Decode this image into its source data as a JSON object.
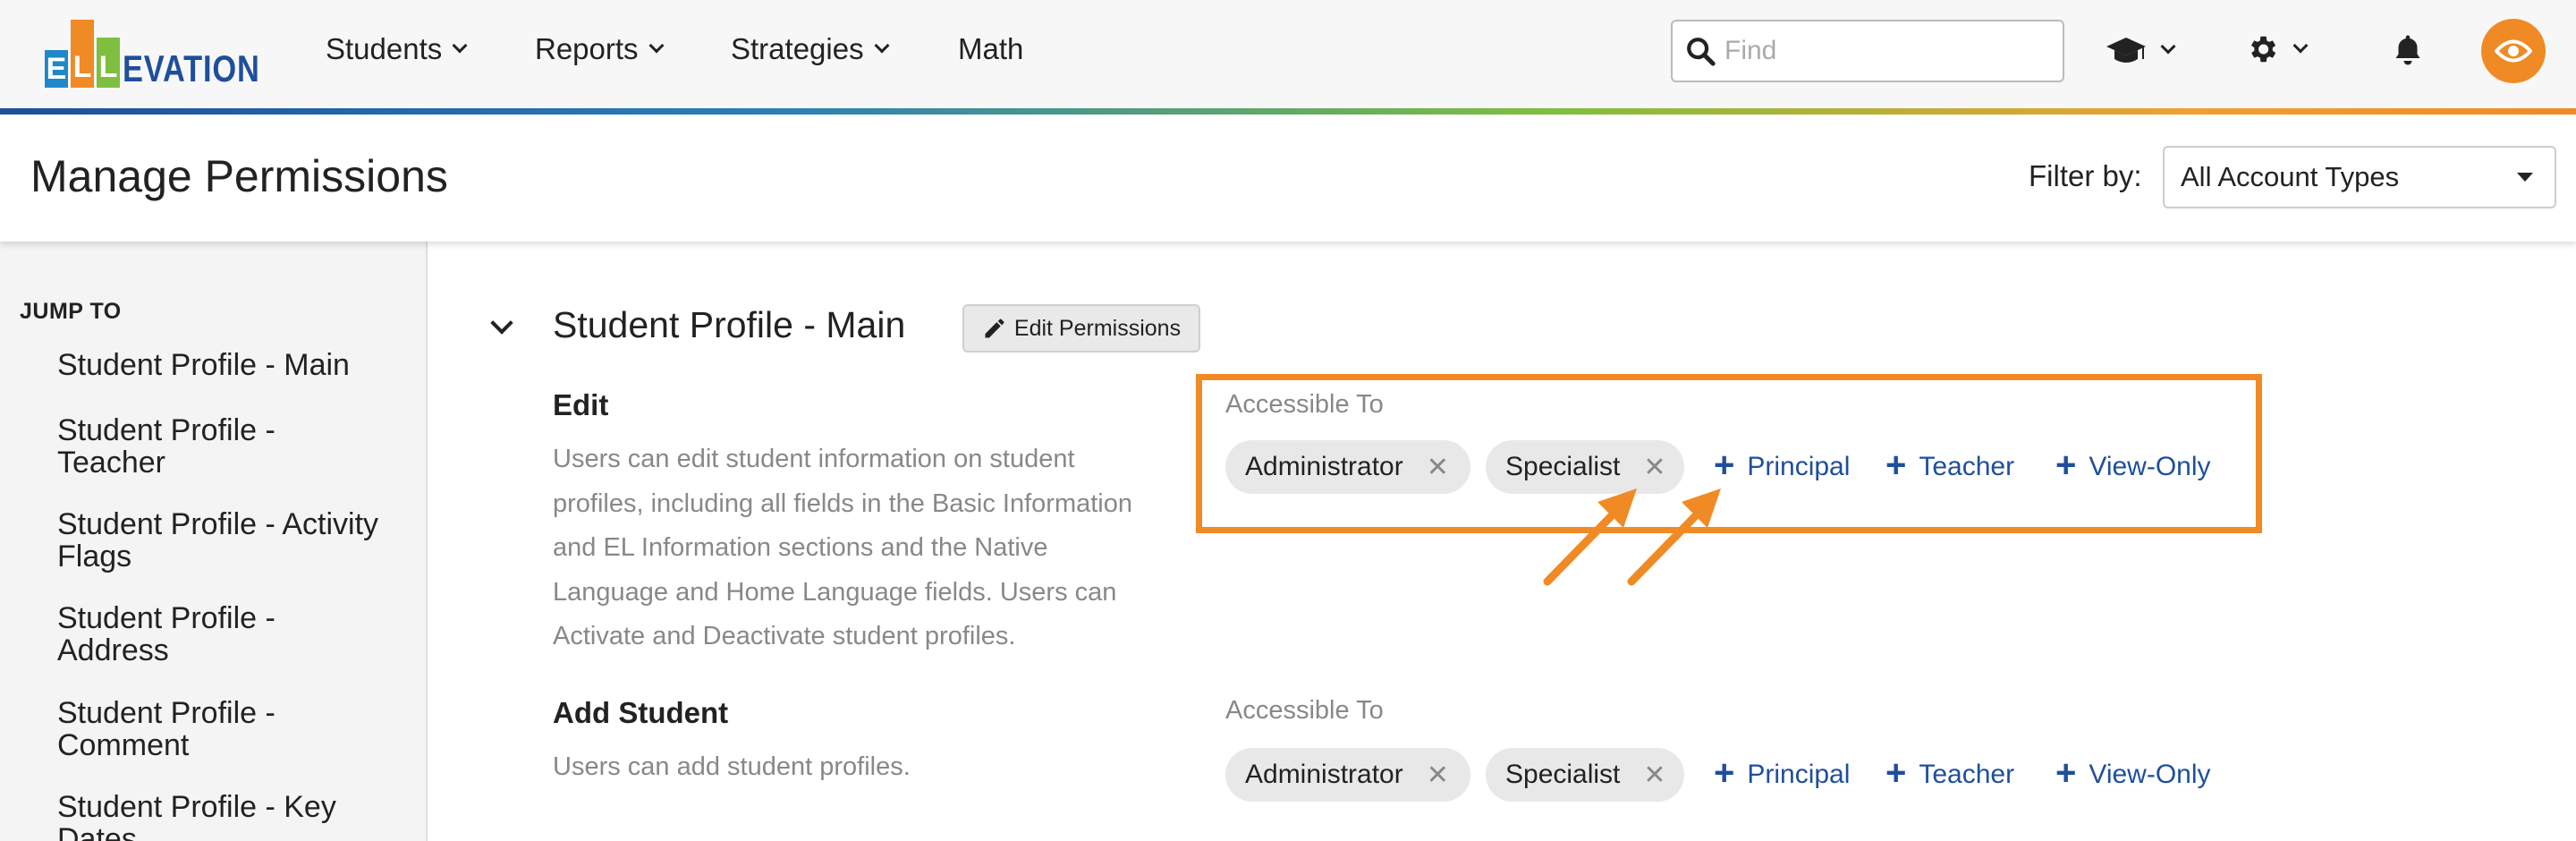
{
  "nav": {
    "logo_letters": [
      "E",
      "L",
      "L"
    ],
    "logo_rest": "EVATION",
    "items": [
      {
        "label": "Students",
        "has_dropdown": true
      },
      {
        "label": "Reports",
        "has_dropdown": true
      },
      {
        "label": "Strategies",
        "has_dropdown": true
      },
      {
        "label": "Math",
        "has_dropdown": false
      }
    ],
    "search_placeholder": "Find",
    "icons": [
      "graduation-cap-icon",
      "gear-icon",
      "bell-icon",
      "eye-icon"
    ]
  },
  "header": {
    "title": "Manage Permissions",
    "filter_label": "Filter by:",
    "filter_value": "All Account Types"
  },
  "sidebar": {
    "heading": "JUMP TO",
    "items": [
      {
        "line1": "Student Profile - Main",
        "line2": ""
      },
      {
        "line1": "Student Profile -",
        "line2": "Teacher"
      },
      {
        "line1": "Student Profile - Activity",
        "line2": "Flags"
      },
      {
        "line1": "Student Profile -",
        "line2": "Address"
      },
      {
        "line1": "Student Profile -",
        "line2": "Comment"
      },
      {
        "line1": "Student Profile - Key",
        "line2": "Dates"
      }
    ]
  },
  "section": {
    "title": "Student Profile - Main",
    "edit_button": "Edit Permissions",
    "permissions": [
      {
        "name": "Edit",
        "description_lines": [
          "Users can edit student information on student",
          "profiles, including all fields in the Basic Information",
          "and EL Information sections and the Native",
          "Language and Home Language fields. Users can",
          "Activate and Deactivate student profiles."
        ],
        "accessible_label": "Accessible To",
        "granted": [
          "Administrator",
          "Specialist"
        ],
        "add_options": [
          "Principal",
          "Teacher",
          "View-Only"
        ]
      },
      {
        "name": "Add Student",
        "description_lines": [
          "Users can add student profiles."
        ],
        "accessible_label": "Accessible To",
        "granted": [
          "Administrator",
          "Specialist"
        ],
        "add_options": [
          "Principal",
          "Teacher",
          "View-Only"
        ]
      }
    ]
  },
  "colors": {
    "accent_orange": "#f08a24",
    "link_blue": "#1e4f9c",
    "brand_blue": "#1e88c8",
    "brand_green": "#7fbf3f"
  }
}
